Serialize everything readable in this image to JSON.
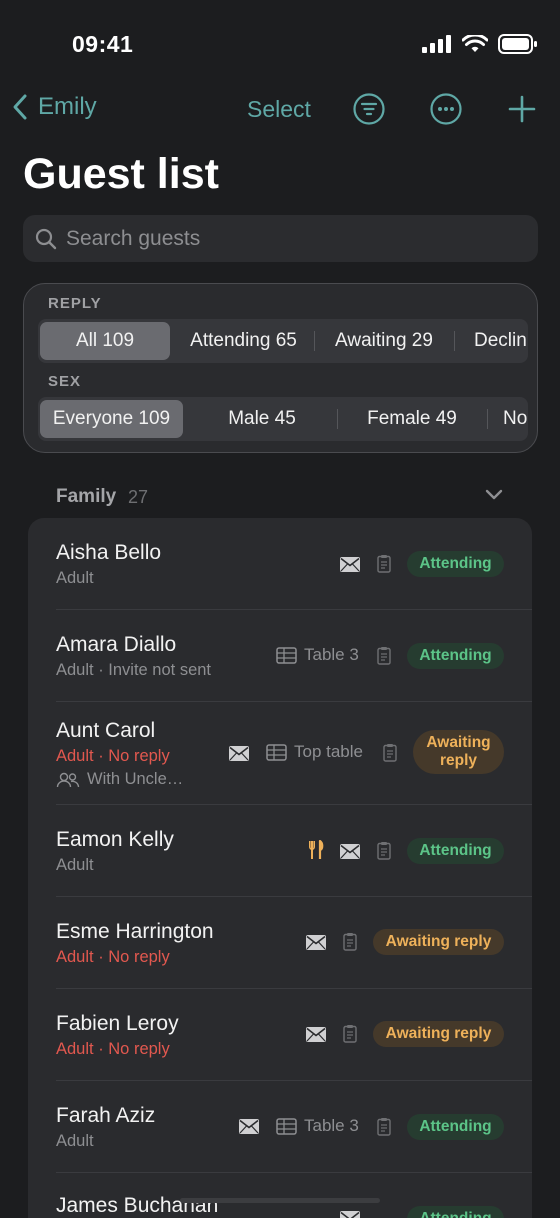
{
  "status_bar": {
    "time": "09:41"
  },
  "nav": {
    "back_label": "Emily",
    "select_label": "Select"
  },
  "page": {
    "title": "Guest list"
  },
  "search": {
    "placeholder": "Search guests"
  },
  "filters": {
    "reply_label": "REPLY",
    "reply_options": [
      "All 109",
      "Attending 65",
      "Awaiting 29",
      "Declin"
    ],
    "sex_label": "SEX",
    "sex_options": [
      "Everyone 109",
      "Male 45",
      "Female 49",
      "No"
    ]
  },
  "section": {
    "title": "Family",
    "count": "27"
  },
  "guests": [
    {
      "name": "Aisha Bello",
      "sub": "Adult",
      "status": "Attending"
    },
    {
      "name": "Amara Diallo",
      "sub": "Adult · Invite not sent",
      "table": "Table 3",
      "status": "Attending"
    },
    {
      "name": "Aunt Carol",
      "sub": "Adult · No reply",
      "extra": "With Uncle…",
      "table": "Top table",
      "status": "Awaiting\nreply"
    },
    {
      "name": "Eamon Kelly",
      "sub": "Adult",
      "status": "Attending"
    },
    {
      "name": "Esme Harrington",
      "sub": "Adult · No reply",
      "status": "Awaiting reply"
    },
    {
      "name": "Fabien Leroy",
      "sub": "Adult · No reply",
      "status": "Awaiting reply"
    },
    {
      "name": "Farah Aziz",
      "sub": "Adult",
      "table": "Table 3",
      "status": "Attending"
    },
    {
      "name": "James Buchanan",
      "status": "Attending"
    }
  ],
  "colors": {
    "accent": "#5fa8a6",
    "attending": "#5cc488",
    "awaiting": "#eeb15a",
    "no_reply": "#e2584f",
    "meal": "#eeb15a"
  }
}
